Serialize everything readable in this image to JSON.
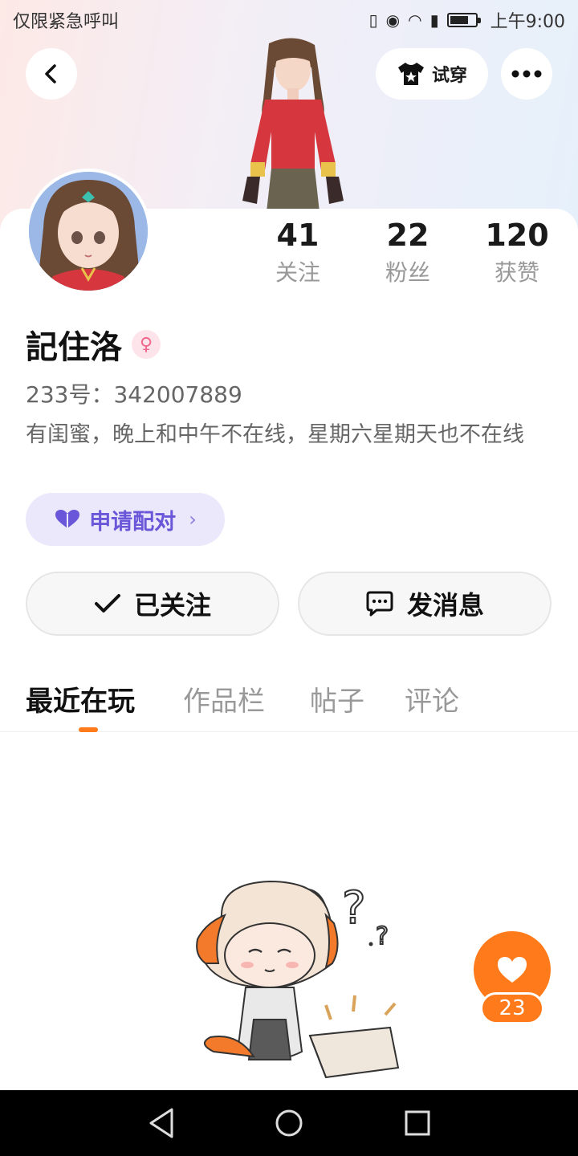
{
  "status_bar": {
    "carrier": "仅限紧急呼叫",
    "time": "上午9:00"
  },
  "header": {
    "try_on_label": "试穿"
  },
  "stats": [
    {
      "value": "41",
      "label": "关注"
    },
    {
      "value": "22",
      "label": "粉丝"
    },
    {
      "value": "120",
      "label": "获赞"
    }
  ],
  "profile": {
    "name": "記住洛",
    "gender_symbol": "♀",
    "uid": "233号：342007889",
    "bio": "有闺蜜，晚上和中午不在线，星期六星期天也不在线"
  },
  "pair_button": {
    "label": "申请配对",
    "chevron": "›"
  },
  "actions": {
    "follow_label": "已关注",
    "message_label": "发消息"
  },
  "tabs": [
    {
      "label": "最近在玩"
    },
    {
      "label": "作品栏"
    },
    {
      "label": "帖子"
    },
    {
      "label": "评论"
    }
  ],
  "like": {
    "count": "23"
  },
  "colors": {
    "accent": "#ff7a1a",
    "pair": "#6a56d8",
    "gender": "#f2668c"
  },
  "icons": [
    "back-icon",
    "shirt-icon",
    "more-icon",
    "heart-icon",
    "check-icon",
    "chat-icon",
    "back-triangle-icon",
    "home-circle-icon",
    "recents-square-icon"
  ]
}
